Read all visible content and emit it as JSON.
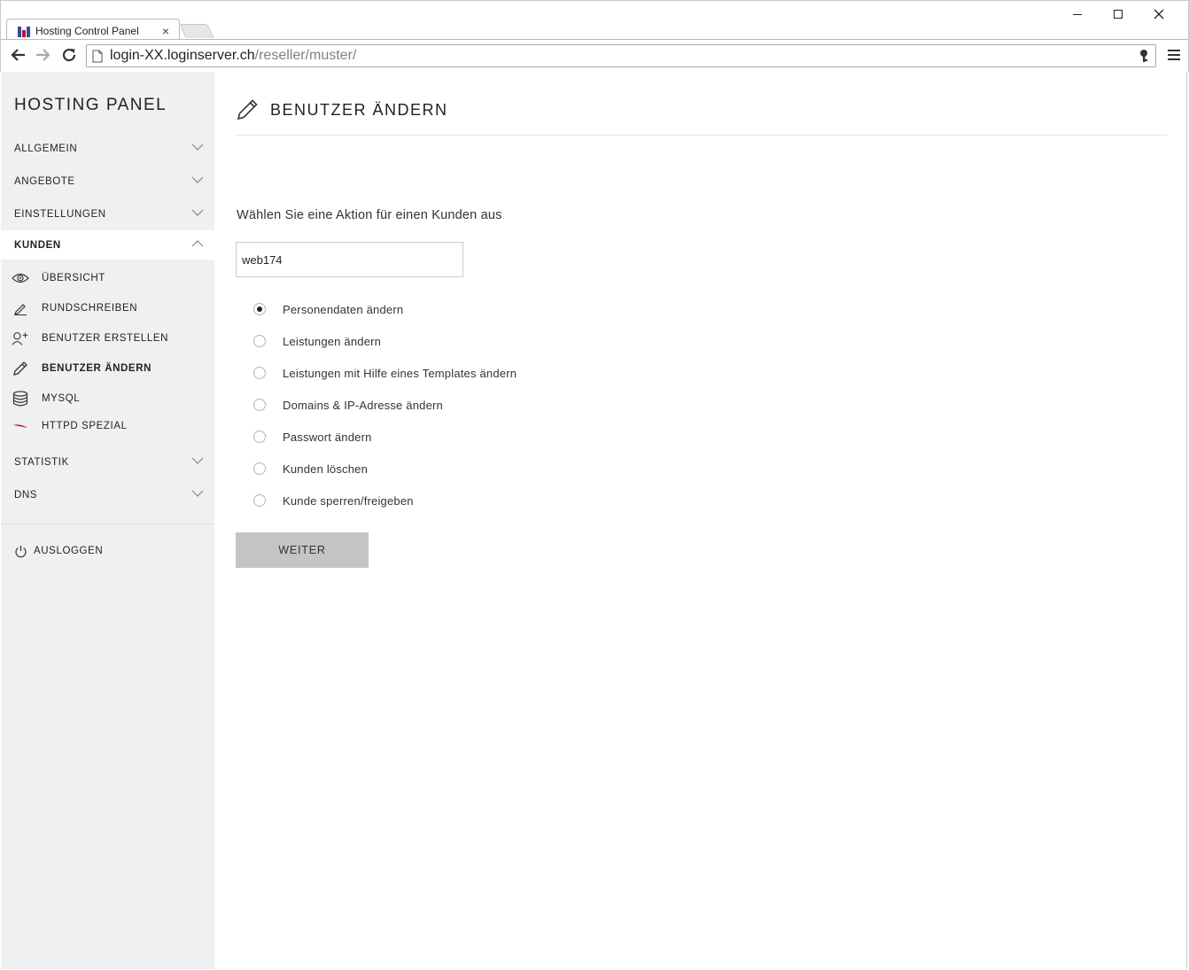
{
  "browser": {
    "tab_title": "Hosting Control Panel",
    "tab_close": "×",
    "url_host": "login-XX.loginserver.ch",
    "url_path": "/reseller/muster/"
  },
  "sidebar": {
    "brand": "HOSTING PANEL",
    "items": [
      {
        "label": "ALLGEMEIN"
      },
      {
        "label": "ANGEBOTE"
      },
      {
        "label": "EINSTELLUNGEN"
      },
      {
        "label": "KUNDEN"
      }
    ],
    "sub_items": [
      {
        "label": "ÜBERSICHT",
        "icon": "eye-icon"
      },
      {
        "label": "RUNDSCHREIBEN",
        "icon": "edit-icon"
      },
      {
        "label": "BENUTZER ERSTELLEN",
        "icon": "add-user-icon"
      },
      {
        "label": "BENUTZER ÄNDERN",
        "icon": "pencil-icon"
      },
      {
        "label": "MYSQL",
        "icon": "database-icon"
      },
      {
        "label": "HTTPD SPEZIAL",
        "icon": "feather-icon"
      }
    ],
    "items_after": [
      {
        "label": "STATISTIK"
      },
      {
        "label": "DNS"
      }
    ],
    "logout": "AUSLOGGEN"
  },
  "main": {
    "title": "BENUTZER ÄNDERN",
    "prompt": "Wählen Sie eine Aktion für einen Kunden aus",
    "customer_value": "web174",
    "options": [
      {
        "label": "Personendaten ändern",
        "checked": true
      },
      {
        "label": "Leistungen ändern",
        "checked": false
      },
      {
        "label": "Leistungen mit Hilfe eines Templates ändern",
        "checked": false
      },
      {
        "label": "Domains & IP-Adresse ändern",
        "checked": false
      },
      {
        "label": "Passwort ändern",
        "checked": false
      },
      {
        "label": "Kunden löschen",
        "checked": false
      },
      {
        "label": "Kunde sperren/freigeben",
        "checked": false
      }
    ],
    "submit_label": "WEITER"
  },
  "colors": {
    "sidebar_bg": "#f0f0f3",
    "button_bg": "#c4c4c4",
    "favicon_blue": "#2a4fa0",
    "favicon_red": "#c8102e",
    "feather_red": "#b0102a"
  }
}
